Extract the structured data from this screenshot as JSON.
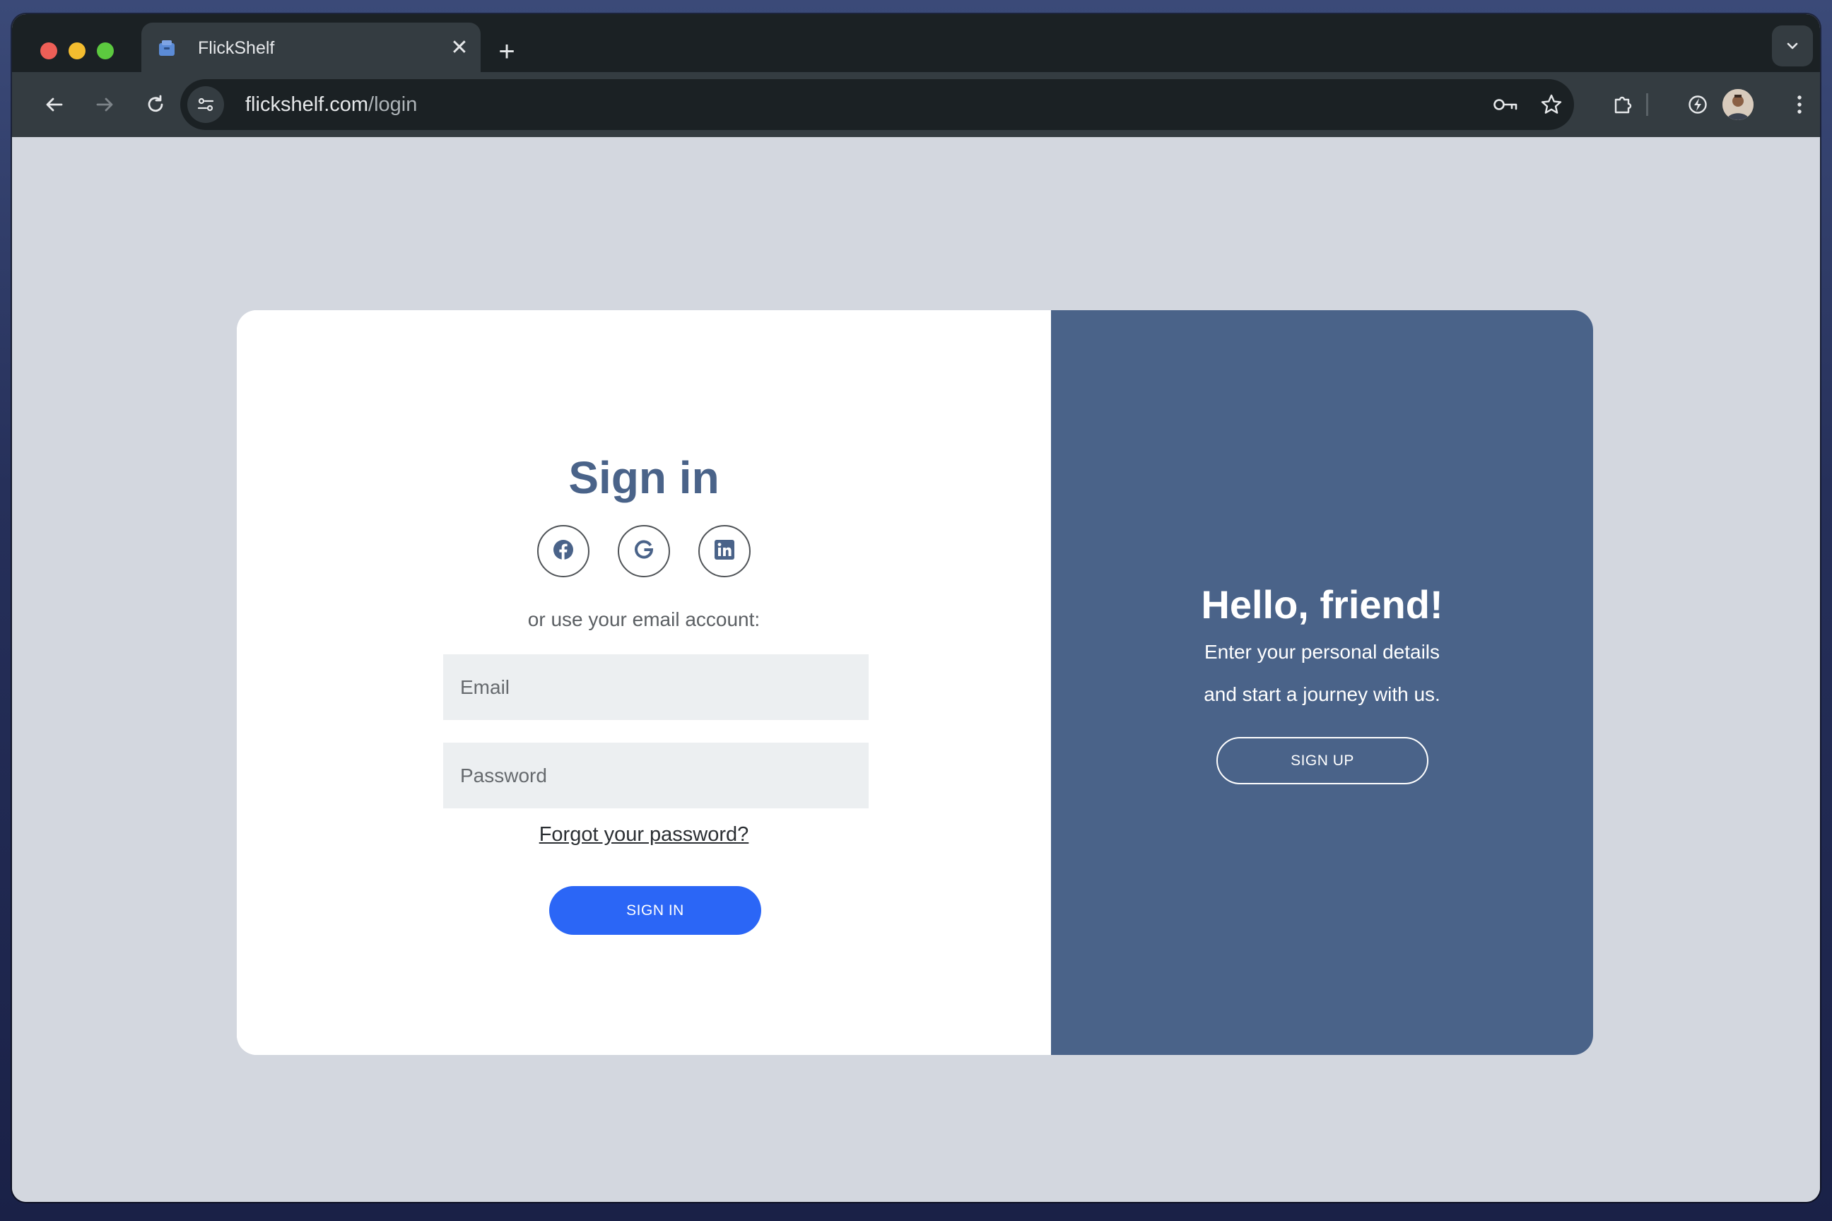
{
  "browser": {
    "tab_title": "FlickShelf",
    "tab_close": "✕",
    "new_tab": "+",
    "url_host": "flickshelf.com",
    "url_path": "/login",
    "icons": [
      "folder-icon",
      "back-icon",
      "forward-icon",
      "reload-icon",
      "site-settings-icon",
      "password-key-icon",
      "bookmark-star-icon",
      "extensions-icon",
      "performance-icon",
      "profile-avatar",
      "more-menu-icon",
      "tab-search-chevron-icon"
    ]
  },
  "signin": {
    "title": "Sign in",
    "social_icons": [
      "facebook-icon",
      "google-icon",
      "linkedin-icon"
    ],
    "alt_text": "or use your email account:",
    "email_placeholder": "Email",
    "password_placeholder": "Password",
    "forgot_link": "Forgot your password?",
    "button_label": "SIGN IN"
  },
  "hello": {
    "title": "Hello, friend!",
    "line1": "Enter your personal details",
    "line2": "and start a journey with us.",
    "button_label": "SIGN UP"
  },
  "colors": {
    "accent": "#4a6389",
    "primary_button": "#2b66f6",
    "page_background": "#d3d7df",
    "input_background": "#eceff1"
  }
}
